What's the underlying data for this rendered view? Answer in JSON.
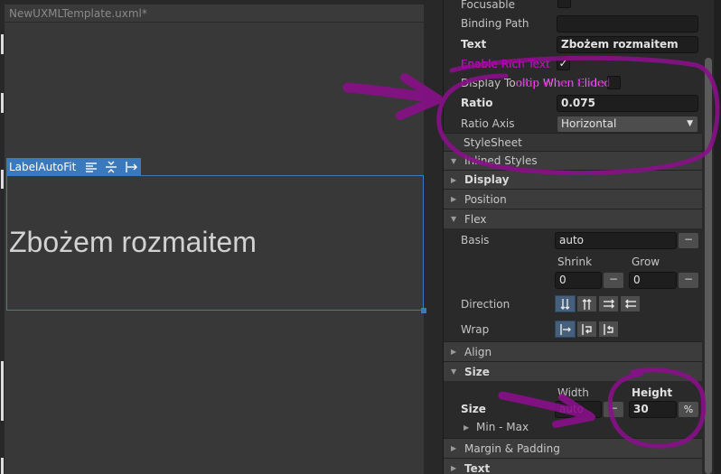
{
  "viewport": {
    "doc_title": "NewUXMLTemplate.uxml*",
    "selection_tag": "LabelAutoFit",
    "selection_icons": [
      "text-align-icon",
      "vertical-fit-icon",
      "horizontal-fit-icon"
    ],
    "label_preview": "Zbożem rozmaitem"
  },
  "inspector": {
    "focusable_label": "Focusable",
    "binding_path_label": "Binding Path",
    "binding_path_value": "",
    "text_label": "Text",
    "text_value": "Zbożem rozmaitem",
    "enable_rich_text_label": "Enable Rich Text",
    "enable_rich_text_checked": "✓",
    "display_tooltip_label": "Display Tooltip When Elided",
    "ratio_label": "Ratio",
    "ratio_value": "0.075",
    "ratio_axis_label": "Ratio Axis",
    "ratio_axis_value": "Horizontal",
    "stylesheet_label": "StyleSheet",
    "inlined_styles_label": "Inlined Styles",
    "display_label": "Display",
    "position_label": "Position",
    "flex_label": "Flex",
    "basis_label": "Basis",
    "basis_value": "auto",
    "shrink_label": "Shrink",
    "shrink_value": "0",
    "grow_label": "Grow",
    "grow_value": "0",
    "direction_label": "Direction",
    "wrap_label": "Wrap",
    "align_label": "Align",
    "size_section_label": "Size",
    "width_label": "Width",
    "height_label": "Height",
    "size_label": "Size",
    "width_value": "auto",
    "height_value": "30",
    "height_unit": "%",
    "min_max_label": "Min - Max",
    "margin_padding_label": "Margin & Padding",
    "text_section_label": "Text",
    "minus": "−"
  },
  "annotation": {
    "color": "#8a0f8a"
  }
}
